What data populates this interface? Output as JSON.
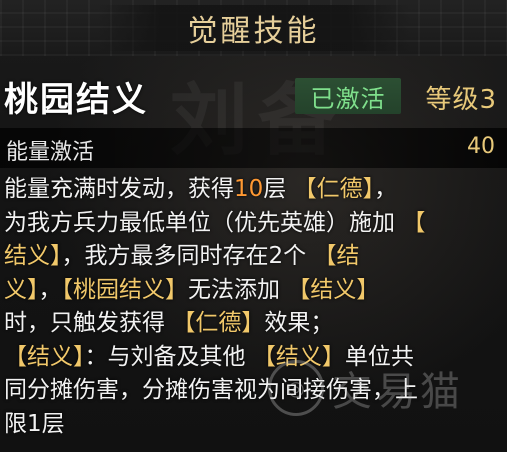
{
  "title": "觉醒技能",
  "skill": {
    "name": "桃园结义",
    "status": "已激活",
    "level": "等级3"
  },
  "energy": {
    "label": "能量激活",
    "value": "40"
  },
  "description": {
    "lines": [
      [
        {
          "t": "能量充满时发动，获得",
          "c": "text"
        },
        {
          "t": "10",
          "c": "num"
        },
        {
          "t": "层 ",
          "c": "text"
        },
        {
          "t": "【仁德】",
          "c": "hl"
        },
        {
          "t": "，",
          "c": "text"
        }
      ],
      [
        {
          "t": "为我方兵力最低单位（优先英雄）施加 ",
          "c": "text"
        },
        {
          "t": "【",
          "c": "hl"
        }
      ],
      [
        {
          "t": "结义】",
          "c": "hl"
        },
        {
          "t": "，我方最多同时存在2个 ",
          "c": "text"
        },
        {
          "t": "【结",
          "c": "hl"
        }
      ],
      [
        {
          "t": "义】",
          "c": "hl"
        },
        {
          "t": "，",
          "c": "text"
        },
        {
          "t": "【桃园结义】",
          "c": "hl"
        },
        {
          "t": "无法添加 ",
          "c": "text"
        },
        {
          "t": "【结义】",
          "c": "hl"
        }
      ],
      [
        {
          "t": "时，只触发获得 ",
          "c": "text"
        },
        {
          "t": "【仁德】",
          "c": "hl"
        },
        {
          "t": "效果；",
          "c": "text"
        }
      ],
      [
        {
          "t": "【结义】",
          "c": "hl"
        },
        {
          "t": "：与刘备及其他 ",
          "c": "text"
        },
        {
          "t": "【结义】",
          "c": "hl"
        },
        {
          "t": "单位共",
          "c": "text"
        }
      ],
      [
        {
          "t": "同分摊伤害，分摊伤害视为间接伤害，上",
          "c": "text"
        }
      ],
      [
        {
          "t": "限1层",
          "c": "text"
        }
      ]
    ]
  },
  "watermark": {
    "text": "交易猫"
  }
}
